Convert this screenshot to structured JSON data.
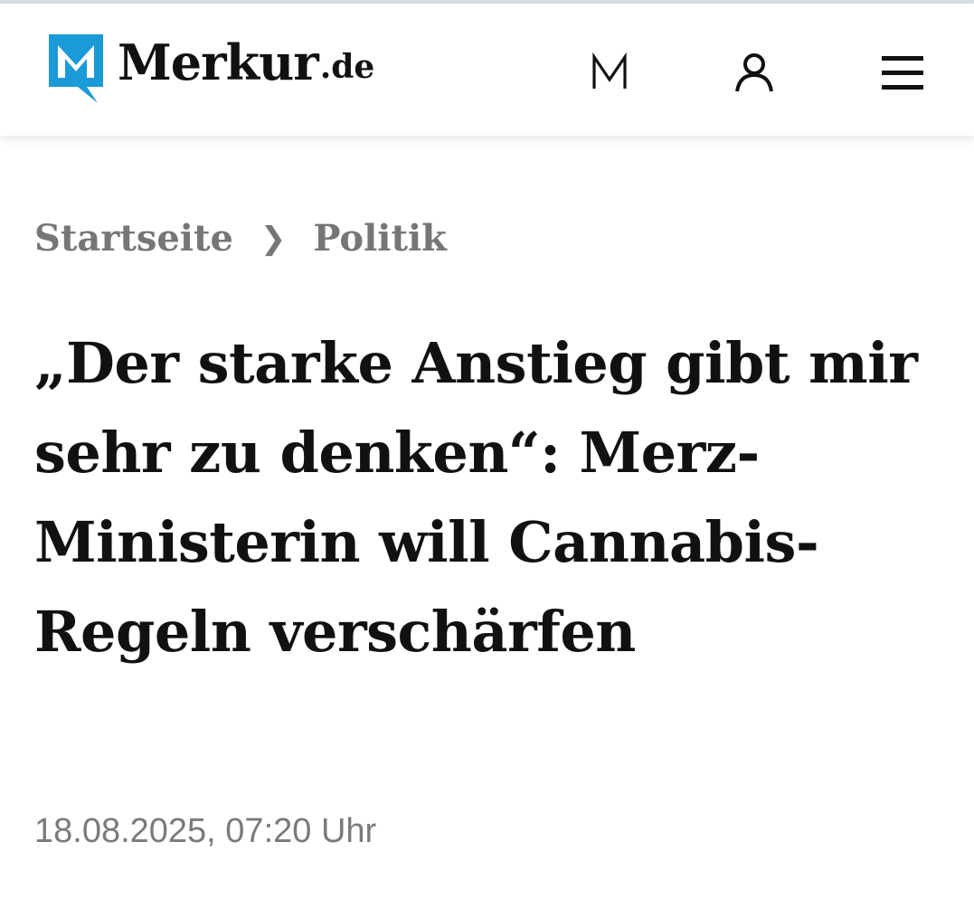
{
  "header": {
    "logo_word": "Merkur",
    "logo_tld": ".de",
    "icons": {
      "m_icon": "merkur-m-icon",
      "user_icon": "user-icon",
      "menu_icon": "hamburger-menu-icon"
    },
    "brand_color": "#1a9ad6"
  },
  "breadcrumb": {
    "items": [
      {
        "label": "Startseite"
      },
      {
        "label": "Politik"
      }
    ],
    "separator": "❯"
  },
  "article": {
    "headline": "„Der starke Anstieg gibt mir sehr zu denken“: Merz-Ministerin will Cannabis-Regeln verschärfen",
    "date": "18.08.2025, 07:20 Uhr"
  }
}
